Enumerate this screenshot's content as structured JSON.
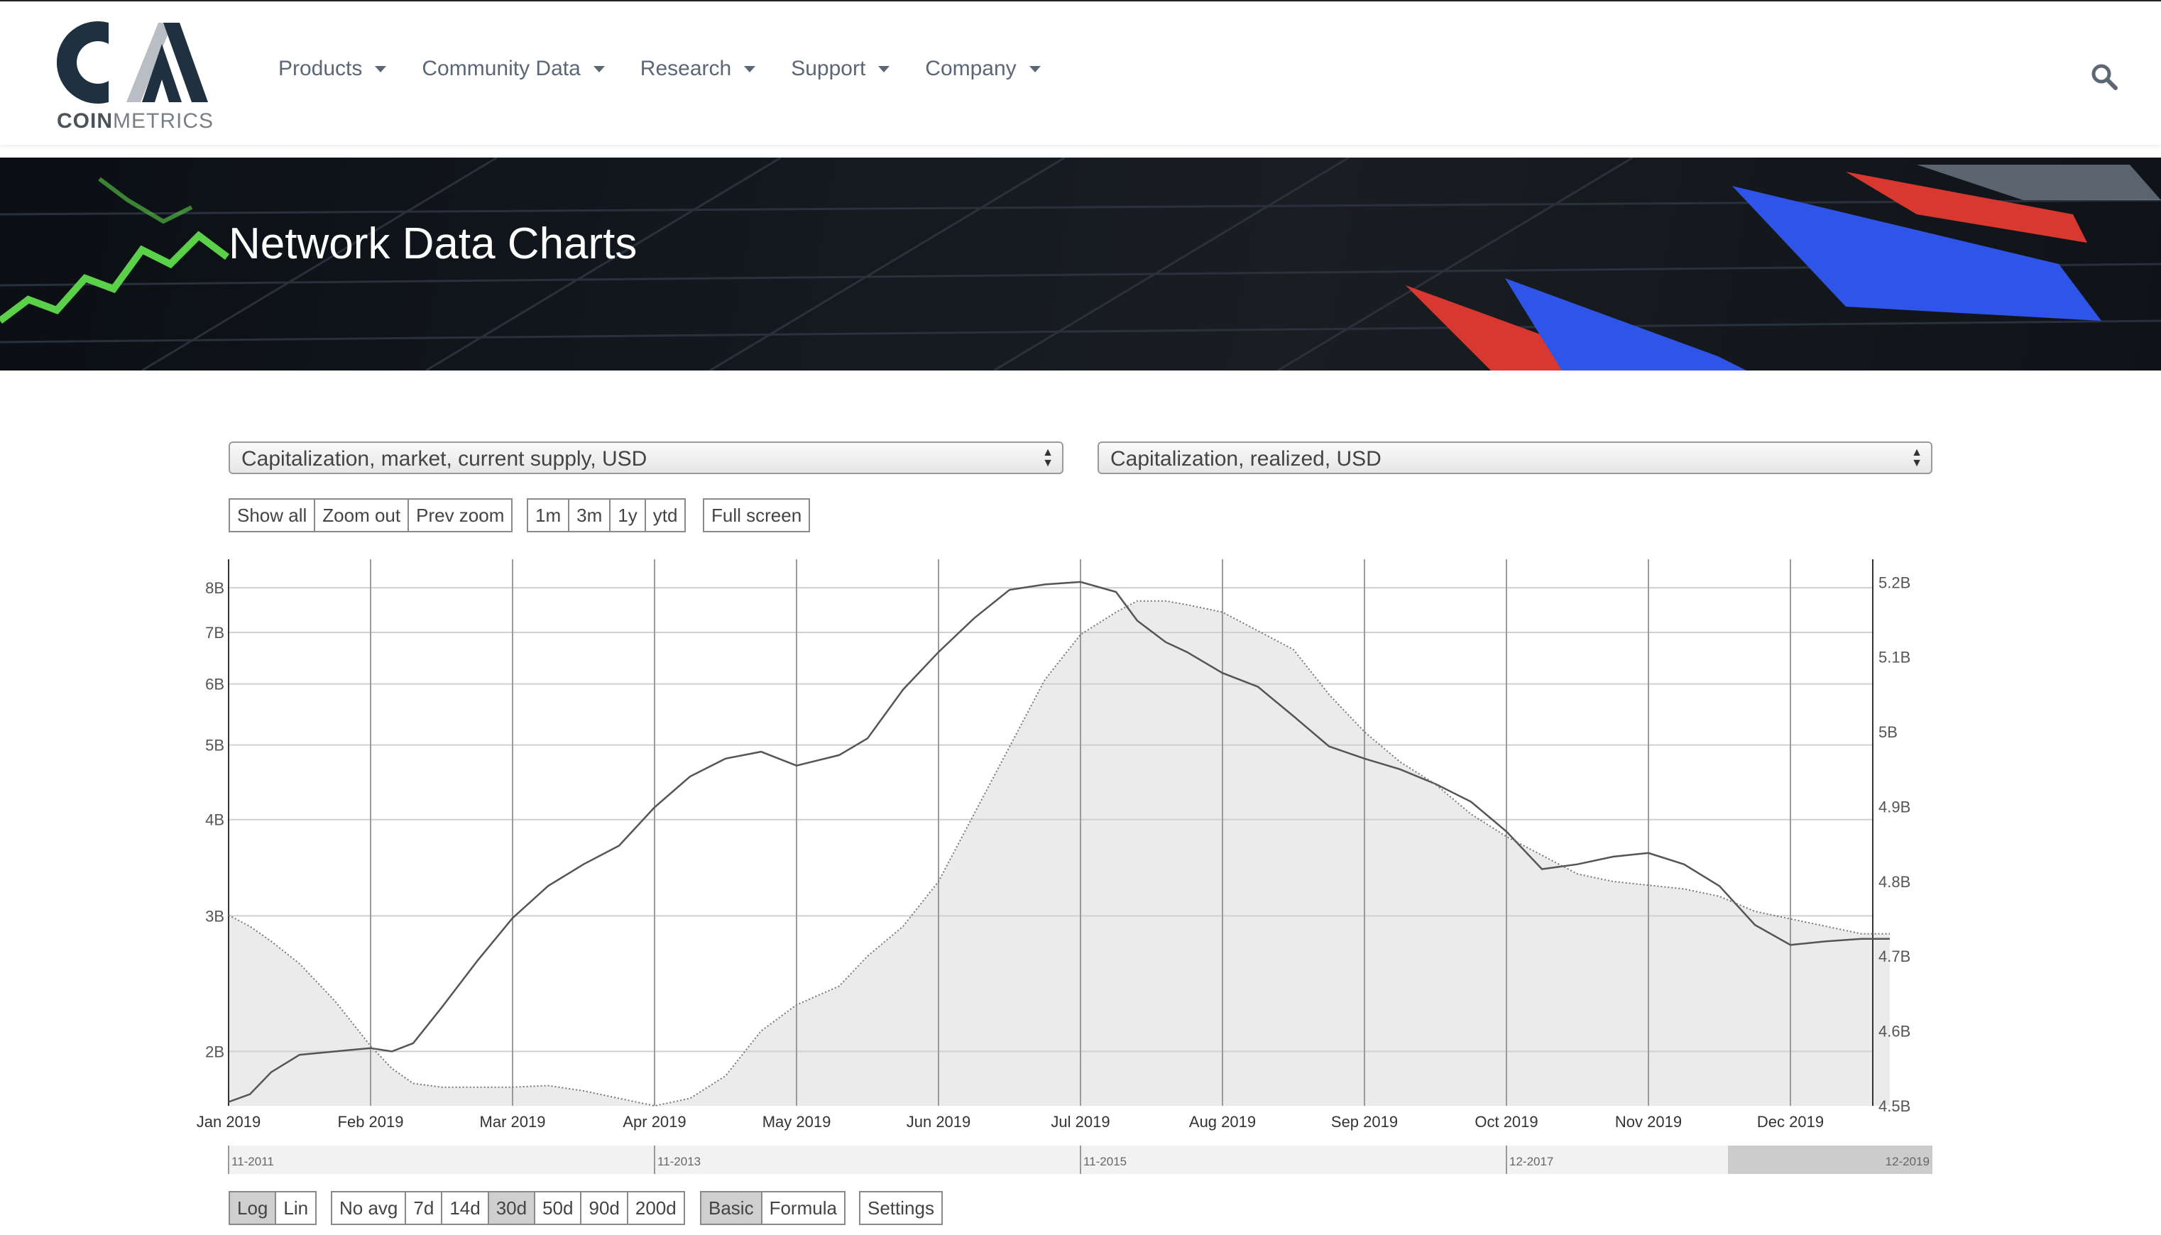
{
  "logo": {
    "mark": "CM",
    "text_bold": "COIN",
    "text_light": "METRICS"
  },
  "nav": [
    "Products",
    "Community Data",
    "Research",
    "Support",
    "Company"
  ],
  "banner": {
    "title": "Network Data Charts"
  },
  "selects": {
    "left": "Capitalization, market, current supply, USD",
    "right": "Capitalization, realized, USD"
  },
  "zoom_buttons": [
    "Show all",
    "Zoom out",
    "Prev zoom"
  ],
  "range_buttons": [
    "1m",
    "3m",
    "1y",
    "ytd"
  ],
  "fullscreen": "Full screen",
  "scale_buttons": {
    "items": [
      "Log",
      "Lin"
    ],
    "active": "Log"
  },
  "avg_buttons": {
    "items": [
      "No avg",
      "7d",
      "14d",
      "30d",
      "50d",
      "90d",
      "200d"
    ],
    "active": "30d"
  },
  "mode_buttons": {
    "items": [
      "Basic",
      "Formula"
    ],
    "active": "Basic"
  },
  "settings": "Settings",
  "chart_data": {
    "type": "line",
    "x_ticks": [
      "Jan 2019",
      "Feb 2019",
      "Mar 2019",
      "Apr 2019",
      "May 2019",
      "Jun 2019",
      "Jul 2019",
      "Aug 2019",
      "Sep 2019",
      "Oct 2019",
      "Nov 2019",
      "Dec 2019"
    ],
    "y_left_scale": "log",
    "y_left_ticks": [
      "2B",
      "3B",
      "4B",
      "5B",
      "6B",
      "7B",
      "8B"
    ],
    "y_left_values": [
      2,
      3,
      4,
      5,
      6,
      7,
      8
    ],
    "y_left_range": [
      1.7,
      8.6
    ],
    "y_right_ticks": [
      "4.5B",
      "4.6B",
      "4.7B",
      "4.8B",
      "4.9B",
      "5B",
      "5.1B",
      "5.2B"
    ],
    "y_right_values": [
      4.5,
      4.6,
      4.7,
      4.8,
      4.9,
      5.0,
      5.1,
      5.2
    ],
    "y_right_range": [
      4.5,
      5.225
    ],
    "x": [
      0,
      0.15,
      0.3,
      0.5,
      0.75,
      1,
      1.15,
      1.3,
      1.5,
      1.75,
      2,
      2.25,
      2.5,
      2.75,
      3,
      3.25,
      3.5,
      3.75,
      4,
      4.3,
      4.5,
      4.75,
      5,
      5.25,
      5.5,
      5.75,
      6,
      6.25,
      6.4,
      6.6,
      6.75,
      7,
      7.25,
      7.5,
      7.75,
      8,
      8.25,
      8.5,
      8.75,
      9,
      9.25,
      9.5,
      9.75,
      10,
      10.25,
      10.5,
      10.75,
      11,
      11.25,
      11.5,
      11.7
    ],
    "series": [
      {
        "axis": "left",
        "style": "line",
        "values": [
          1.72,
          1.76,
          1.88,
          1.98,
          2.0,
          2.02,
          2.0,
          2.05,
          2.28,
          2.62,
          2.98,
          3.28,
          3.5,
          3.7,
          4.15,
          4.55,
          4.8,
          4.9,
          4.7,
          4.85,
          5.1,
          5.9,
          6.6,
          7.3,
          7.95,
          8.08,
          8.14,
          7.9,
          7.25,
          6.8,
          6.6,
          6.2,
          5.95,
          5.45,
          4.98,
          4.8,
          4.65,
          4.45,
          4.22,
          3.86,
          3.45,
          3.5,
          3.58,
          3.62,
          3.5,
          3.28,
          2.92,
          2.75,
          2.78,
          2.8,
          2.8
        ]
      },
      {
        "axis": "right",
        "style": "dotted-area",
        "values": [
          4.755,
          4.74,
          4.72,
          4.69,
          4.64,
          4.58,
          4.55,
          4.53,
          4.525,
          4.525,
          4.525,
          4.527,
          4.52,
          4.51,
          4.5,
          4.51,
          4.54,
          4.6,
          4.635,
          4.66,
          4.7,
          4.74,
          4.8,
          4.89,
          4.98,
          5.07,
          5.13,
          5.16,
          5.175,
          5.175,
          5.17,
          5.16,
          5.135,
          5.11,
          5.05,
          5.0,
          4.96,
          4.93,
          4.89,
          4.86,
          4.835,
          4.81,
          4.8,
          4.795,
          4.79,
          4.78,
          4.76,
          4.75,
          4.74,
          4.73,
          4.73
        ]
      }
    ],
    "navigator_labels": [
      "11-2011",
      "11-2013",
      "11-2015",
      "12-2017",
      "12-2019"
    ]
  }
}
